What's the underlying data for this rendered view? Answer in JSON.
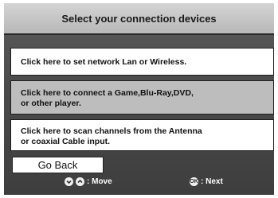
{
  "header": {
    "title": "Select your connection devices"
  },
  "options": [
    {
      "line1": "Click here to set network Lan or Wireless.",
      "line2": ""
    },
    {
      "line1": "Click here to connect a Game,Blu-Ray,DVD,",
      "line2": "or other player."
    },
    {
      "line1": "Click here to scan channels from the Antenna",
      "line2": "or coaxial Cable input."
    }
  ],
  "go_back_label": "Go Back",
  "hints": {
    "move_label": ": Move",
    "next_label": ": Next",
    "ok_glyph": "OK"
  }
}
